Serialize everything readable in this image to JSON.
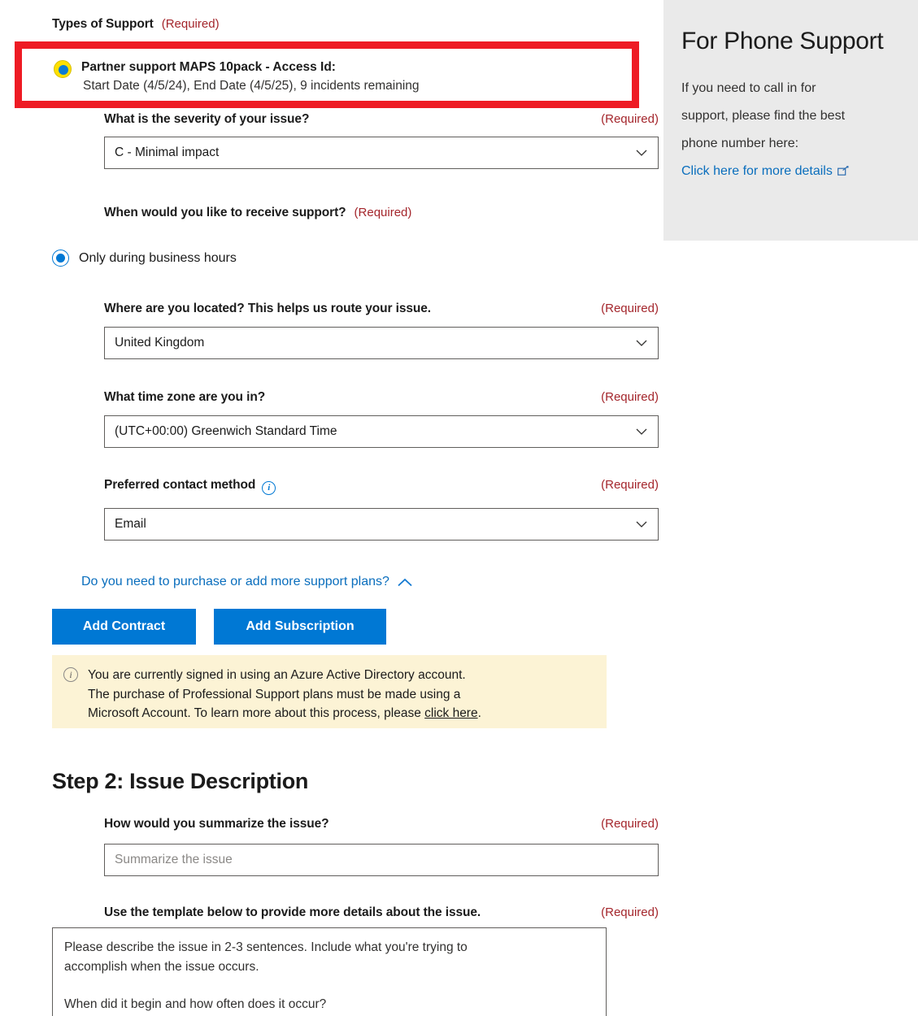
{
  "form": {
    "types_of_support": {
      "label": "Types of Support",
      "required": "(Required)",
      "selected_plan": {
        "title": "Partner support MAPS 10pack - Access Id:",
        "details": "Start Date (4/5/24), End Date (4/5/25), 9 incidents remaining"
      }
    },
    "severity": {
      "label": "What is the severity of your issue?",
      "required": "(Required)",
      "value": "C - Minimal impact"
    },
    "support_time": {
      "label": "When would you like to receive support?",
      "required": "(Required)",
      "option_label": "Only during business hours"
    },
    "location": {
      "label": "Where are you located? This helps us route your issue.",
      "required": "(Required)",
      "value": "United Kingdom"
    },
    "timezone": {
      "label": "What time zone are you in?",
      "required": "(Required)",
      "value": "(UTC+00:00) Greenwich Standard Time"
    },
    "contact_method": {
      "label": "Preferred contact method",
      "required": "(Required)",
      "value": "Email",
      "info_glyph": "i"
    },
    "expander": {
      "label": "Do you need to purchase or add more support plans?"
    },
    "buttons": {
      "add_contract": "Add Contract",
      "add_subscription": "Add Subscription"
    },
    "alert": {
      "glyph": "i",
      "line1": "You are currently signed in using an Azure Active Directory account.",
      "line2": "The purchase of Professional Support plans must be made using a",
      "line3_before": "Microsoft Account. To learn more about this process, please ",
      "link": "click here",
      "line3_after": "."
    }
  },
  "step2": {
    "title": "Step 2: Issue Description",
    "summary": {
      "label": "How would you summarize the issue?",
      "required": "(Required)",
      "placeholder": "Summarize the issue"
    },
    "details": {
      "label": "Use the template below to provide more details about the issue.",
      "required": "(Required)",
      "line1": "Please describe the issue in 2-3 sentences. Include what you're trying to",
      "line2": "accomplish when the issue occurs.",
      "line3": "When did it begin and how often does it occur?"
    }
  },
  "side_panel": {
    "title": "For Phone Support",
    "body_line1": "If you need to call in for",
    "body_line2": "support, please find the best",
    "body_line3": "phone number here:",
    "link_text": "Click here for more details"
  },
  "colors": {
    "highlight_box": "#ee1b24",
    "accent_blue": "#0078d4",
    "required_red": "#a4262c",
    "alert_bg": "#fcf3d5",
    "panel_bg": "#eaeaea",
    "radio_focus_yellow": "#ffe000"
  }
}
